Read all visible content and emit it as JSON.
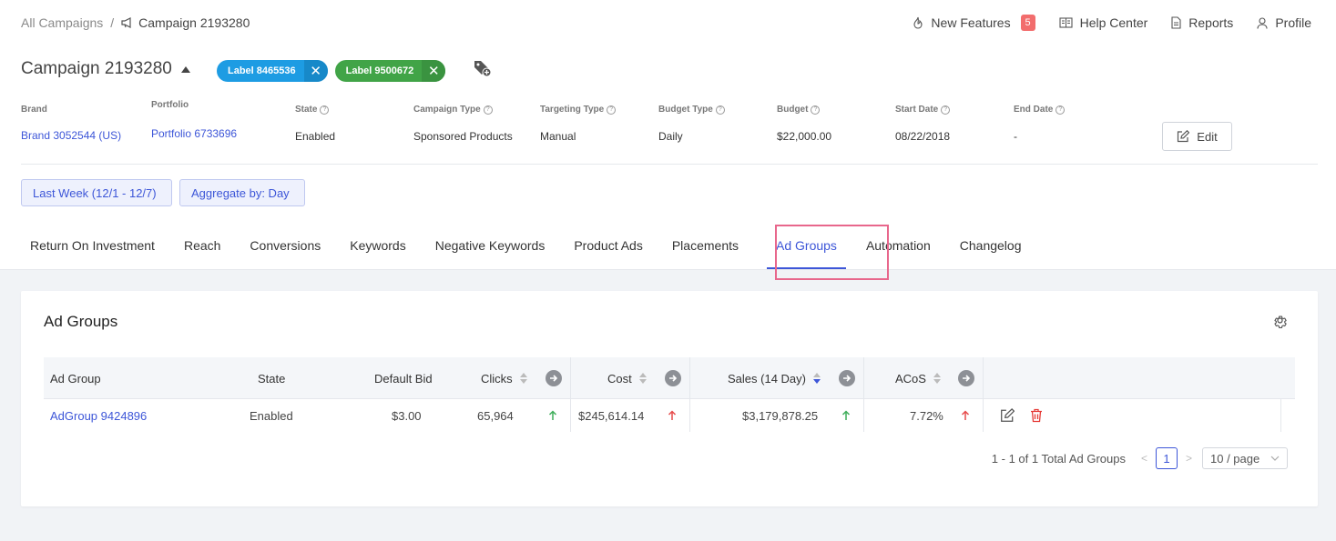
{
  "breadcrumb": {
    "root": "All Campaigns",
    "separator": "/",
    "current": "Campaign 2193280"
  },
  "topnav": {
    "new_features": "New Features",
    "new_features_count": "5",
    "help_center": "Help Center",
    "reports": "Reports",
    "profile": "Profile"
  },
  "campaign": {
    "title": "Campaign 2193280",
    "labels": [
      {
        "text": "Label 8465536",
        "color": "#1d9ce3"
      },
      {
        "text": "Label 9500672",
        "color": "#41a447"
      }
    ]
  },
  "fields": {
    "brand": {
      "label": "Brand",
      "value": "Brand 3052544 (US)"
    },
    "portfolio": {
      "label": "Portfolio",
      "value": "Portfolio 6733696"
    },
    "state": {
      "label": "State",
      "value": "Enabled"
    },
    "campaign_type": {
      "label": "Campaign Type",
      "value": "Sponsored Products"
    },
    "targeting_type": {
      "label": "Targeting Type",
      "value": "Manual"
    },
    "budget_type": {
      "label": "Budget Type",
      "value": "Daily"
    },
    "budget": {
      "label": "Budget",
      "value": "$22,000.00"
    },
    "start_date": {
      "label": "Start Date",
      "value": "08/22/2018"
    },
    "end_date": {
      "label": "End Date",
      "value": "-"
    }
  },
  "edit_label": "Edit",
  "filters": {
    "date_range": "Last Week (12/1 - 12/7)",
    "aggregate": "Aggregate by: Day"
  },
  "tabs": [
    "Return On Investment",
    "Reach",
    "Conversions",
    "Keywords",
    "Negative Keywords",
    "Product Ads",
    "Placements",
    "Ad Groups",
    "Automation",
    "Changelog"
  ],
  "active_tab": "Ad Groups",
  "card": {
    "title": "Ad Groups",
    "columns": {
      "ad_group": "Ad Group",
      "state": "State",
      "default_bid": "Default Bid",
      "clicks": "Clicks",
      "cost": "Cost",
      "sales": "Sales (14 Day)",
      "acos": "ACoS"
    },
    "row": {
      "ad_group": "AdGroup 9424896",
      "state": "Enabled",
      "default_bid": "$3.00",
      "clicks": "65,964",
      "cost": "$245,614.14",
      "sales": "$3,179,878.25",
      "acos": "7.72%"
    },
    "pagination": {
      "summary": "1 - 1 of 1 Total Ad Groups",
      "current_page": "1",
      "page_size": "10 / page"
    }
  },
  "colors": {
    "accent": "#3d56d8",
    "up_green": "#3fae5a",
    "up_red": "#e64b4b",
    "highlight": "#e8678c"
  }
}
